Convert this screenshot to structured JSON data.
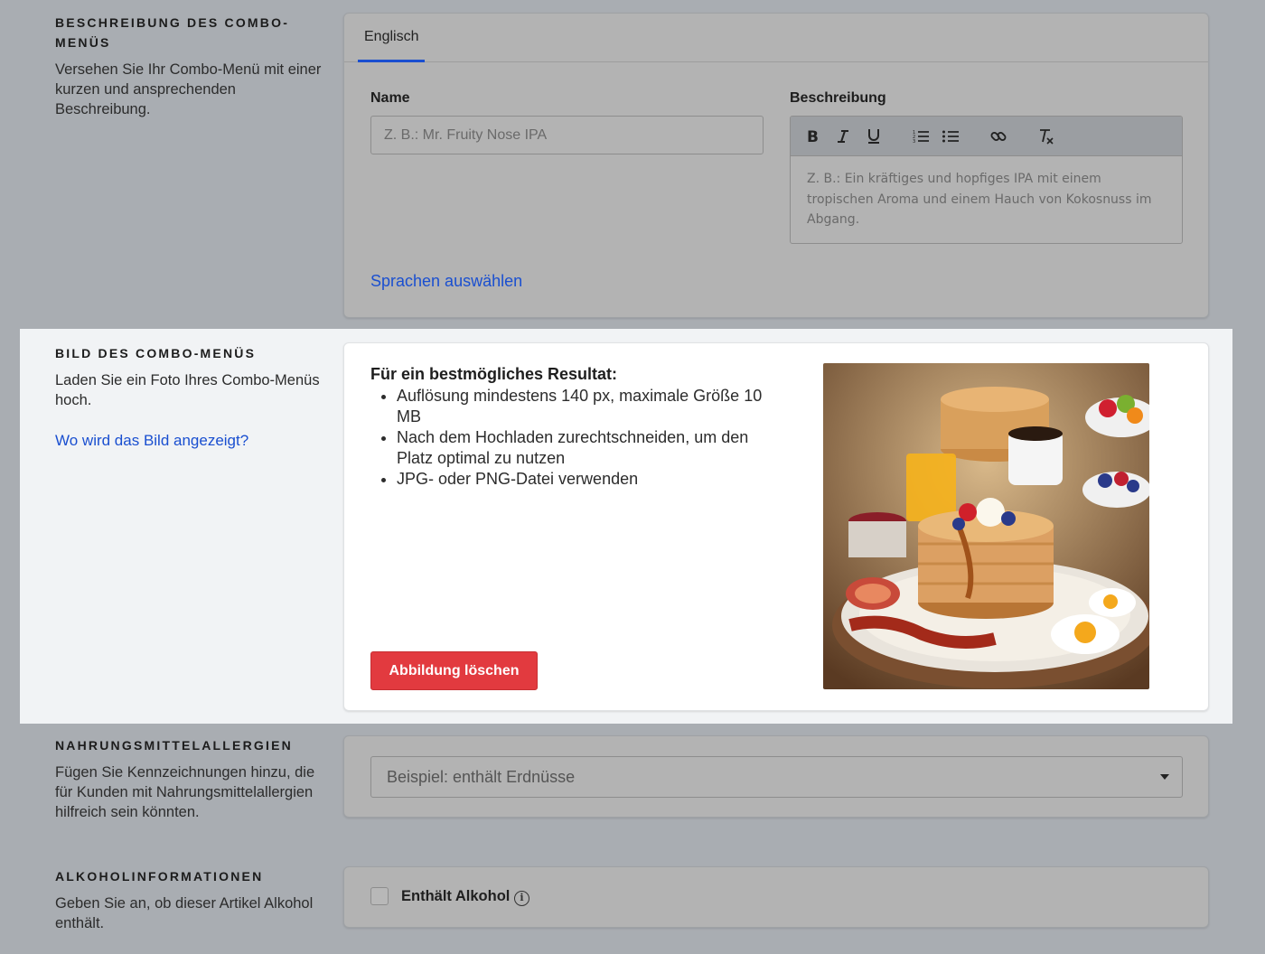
{
  "sections": {
    "description": {
      "title": "Beschreibung des Combo-Menüs",
      "desc": "Versehen Sie Ihr Combo-Menü mit einer kurzen und ansprechenden Beschreibung.",
      "tab": "Englisch",
      "name_label": "Name",
      "name_placeholder": "Z. B.: Mr. Fruity Nose IPA",
      "desc_label": "Beschreibung",
      "desc_placeholder": "Z. B.: Ein kräftiges und hopfiges IPA mit einem tropischen Aroma und einem Hauch von Kokosnuss im Abgang.",
      "languages_link": "Sprachen auswählen",
      "toolbar": [
        "bold-icon",
        "italic-icon",
        "underline-icon",
        "ordered-list-icon",
        "bullet-list-icon",
        "link-icon",
        "clear-format-icon"
      ]
    },
    "image": {
      "title": "Bild des Combo-Menüs",
      "desc": "Laden Sie ein Foto Ihres Combo-Menüs hoch.",
      "where_link": "Wo wird das Bild angezeigt?",
      "tips_title": "Für ein bestmögliches Resultat:",
      "tips": [
        "Auflösung mindestens 140 px, maximale Größe 10 MB",
        "Nach dem Hochladen zurechtschneiden, um den Platz optimal zu nutzen",
        "JPG- oder PNG-Datei verwenden"
      ],
      "delete_label": "Abbildung löschen"
    },
    "allergies": {
      "title": "Nahrungsmittelallergien",
      "desc": "Fügen Sie Kennzeichnungen hinzu, die für Kunden mit Nahrungsmittelallergien hilfreich sein könnten.",
      "select_placeholder": "Beispiel: enthält Erdnüsse"
    },
    "alcohol": {
      "title": "Alkoholinformationen",
      "desc": "Geben Sie an, ob dieser Artikel Alkohol enthält.",
      "checkbox_label": "Enthält Alkohol",
      "checked": false
    }
  },
  "colors": {
    "page_bg": "#a9adb2",
    "highlight_bg": "#f1f3f5",
    "link": "#1a4fd0",
    "danger": "#e23a3f"
  }
}
